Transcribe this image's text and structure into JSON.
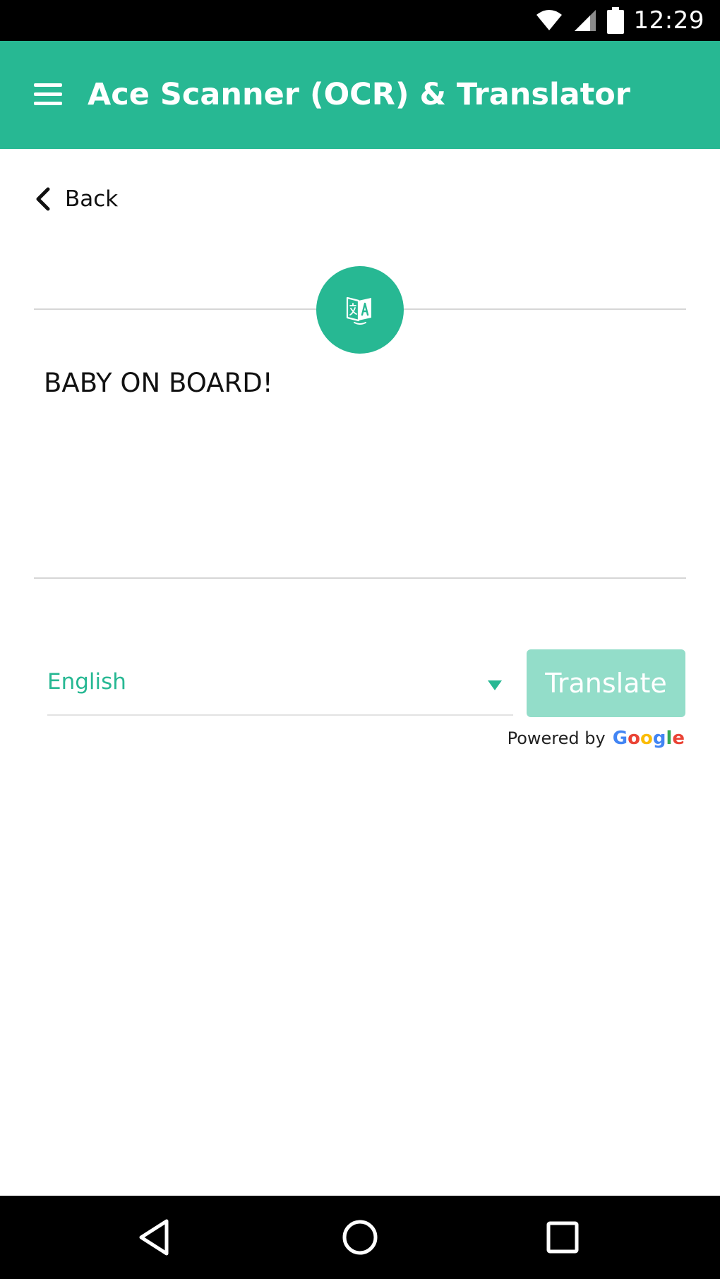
{
  "status_bar": {
    "time": "12:29",
    "icons": [
      "wifi-icon",
      "cell-signal-icon",
      "battery-icon"
    ]
  },
  "app_bar": {
    "title": "Ace Scanner (OCR) & Translator",
    "menu_icon": "hamburger-menu-icon"
  },
  "back": {
    "label": "Back",
    "icon": "chevron-left-icon"
  },
  "scan": {
    "badge_icon": "translate-icon",
    "text": "BABY ON BOARD!"
  },
  "language": {
    "selected": "English",
    "icon": "dropdown-triangle-icon"
  },
  "translate_button": {
    "label": "Translate"
  },
  "attribution": {
    "powered_by": "Powered by",
    "logo_text": "Google"
  },
  "nav_bar": {
    "icons": [
      "nav-back-icon",
      "nav-home-icon",
      "nav-recents-icon"
    ]
  },
  "colors": {
    "brand": "#27b893",
    "button_disabled": "#93ddc9",
    "divider": "#d6d6d6"
  }
}
